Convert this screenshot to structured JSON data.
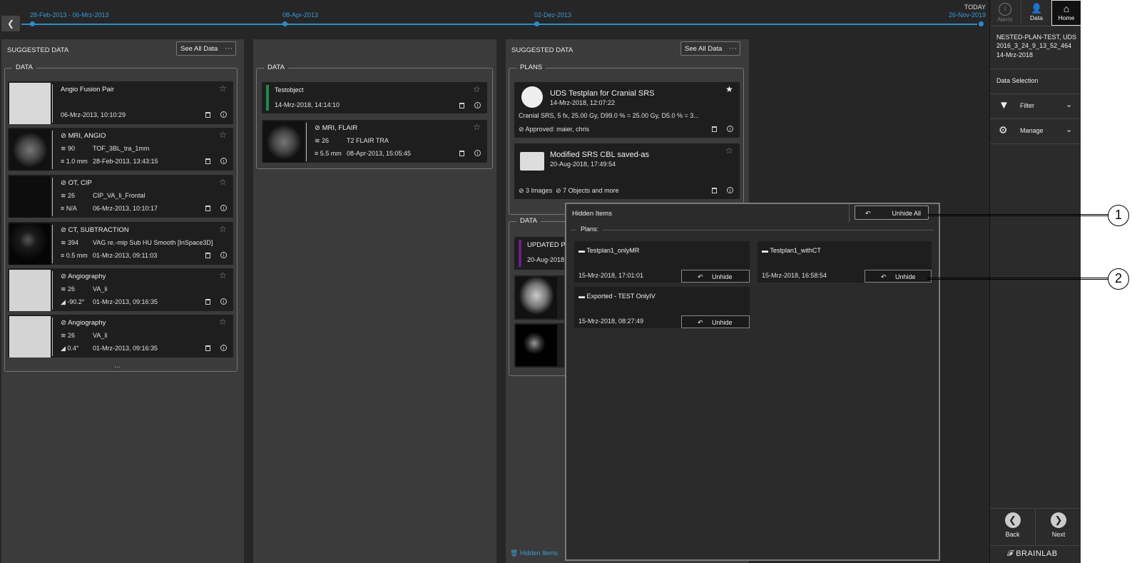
{
  "timeline": {
    "ranges": [
      "28-Feb-2013 - 06-Mrz-2013",
      "08-Apr-2013",
      "02-Dez-2013",
      "26-Nov-2019"
    ],
    "today_label": "TODAY",
    "accent": "#2d8ccc"
  },
  "col1": {
    "header": "SUGGESTED DATA",
    "see_all": "See All Data",
    "section": "DATA",
    "more": "...",
    "cards": [
      {
        "title": "Angio Fusion Pair",
        "date": "06-Mrz-2013, 10:10:29"
      },
      {
        "title": "MRI, ANGIO",
        "count": "90",
        "series": "TOF_3BL_tra_1mm",
        "metric": "1.0 mm",
        "date": "28-Feb-2013, 13:43:15"
      },
      {
        "title": "OT, CIP",
        "count": "26",
        "series": "CIP_VA_li_Frontal",
        "metric": "N/A",
        "date": "06-Mrz-2013, 10:10:17"
      },
      {
        "title": "CT, SUBTRACTION",
        "count": "394",
        "series": "VAG re.-mip Sub HU Smooth [InSpace3D]",
        "metric": "0.5 mm",
        "date": "01-Mrz-2013, 09:11:03"
      },
      {
        "title": "Angiography",
        "count": "26",
        "series": "VA_li",
        "metric": "-90.2°",
        "date": "01-Mrz-2013, 09:16:35"
      },
      {
        "title": "Angiography",
        "count": "26",
        "series": "VA_li",
        "metric": "0.4°",
        "date": "01-Mrz-2013, 09:16:35"
      }
    ]
  },
  "col2": {
    "section": "DATA",
    "testobject": {
      "title": "Testobject",
      "date": "14-Mrz-2018, 14:14:10"
    },
    "mri": {
      "title": "MRI, FLAIR",
      "count": "26",
      "series": "T2 FLAIR TRA",
      "metric": "5.5 mm",
      "date": "08-Apr-2013, 15:05:45"
    }
  },
  "col3": {
    "header": "SUGGESTED DATA",
    "see_all": "See All Data",
    "plans_section": "PLANS",
    "data_section": "DATA",
    "plan1": {
      "title": "UDS Testplan for Cranial SRS",
      "date": "14-Mrz-2018, 12:07:22",
      "details": "Cranial SRS, 5 fx, 25.00 Gy, D99.0 % = 25.00 Gy, D5.0 % = 3...",
      "approved_label": "Approved:",
      "approved_by": "maier, chris"
    },
    "plan2": {
      "title": "Modified SRS CBL saved-as",
      "date": "20-Aug-2018, 17:49:54",
      "images": "3 Images",
      "objects": "7 Objects and more"
    },
    "data_card": {
      "title": "UPDATED PT",
      "date": "20-Aug-2018"
    },
    "hidden_link": "Hidden Items"
  },
  "overlay": {
    "title": "Hidden Items",
    "unhide_all": "Unhide All",
    "plans_label": "Plans:",
    "unhide_label": "Unhide",
    "items": [
      {
        "title": "Testplan1_onlyMR",
        "date": "15-Mrz-2018, 17:01:01"
      },
      {
        "title": "Testplan1_withCT",
        "date": "15-Mrz-2018, 16:58:54"
      },
      {
        "title": "Exported - TEST OnlyIV",
        "date": "15-Mrz-2018, 08:27:49"
      }
    ]
  },
  "sidebar": {
    "alerts": "Alerts",
    "data": "Data",
    "home": "Home",
    "patient": "NESTED-PLAN-TEST, UDS 2016_3_24_9_13_52_464",
    "patient_date": "14-Mrz-2018",
    "data_selection": "Data Selection",
    "filter": "Filter",
    "manage": "Manage",
    "back": "Back",
    "next": "Next",
    "brand": "BRAINLAB"
  },
  "callouts": [
    "1",
    "2"
  ]
}
